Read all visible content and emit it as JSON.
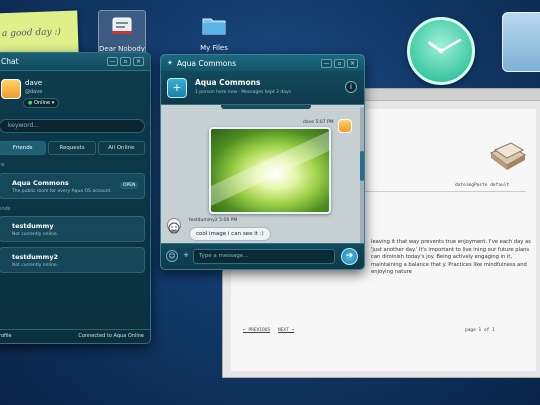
{
  "desktop": {
    "sticky_note": "a good day :)",
    "icons": [
      {
        "label": "Dear Nobody",
        "icon": "document-icon"
      },
      {
        "label": "My Files",
        "icon": "folder-icon"
      }
    ],
    "clock": {
      "hour": 10,
      "minute": 10,
      "color": "#3fc9a2"
    }
  },
  "chat_window": {
    "title": "Chat",
    "controls": [
      "—",
      "▫",
      "×"
    ],
    "user": {
      "name": "dave",
      "handle": "@dave",
      "status": "Online"
    },
    "search_placeholder": "keyword...",
    "tabs": [
      "Friends",
      "Requests",
      "All Online"
    ],
    "sections": {
      "rooms": "ms",
      "friends": "iends"
    },
    "rooms": [
      {
        "name": "Aqua Commons",
        "subtitle": "The public room for every Aqua OS account.",
        "action": "OPEN"
      }
    ],
    "friends": [
      {
        "name": "testdummy",
        "status": "Not currently online."
      },
      {
        "name": "testdummy2",
        "status": "Not currently online."
      }
    ],
    "footer_left": "rofile",
    "footer_right": "Connected to Aqua Online",
    "accent": "#1f5f74"
  },
  "conversation": {
    "title": "Aqua Commons",
    "controls": [
      "—",
      "▫",
      "×"
    ],
    "room_name": "Aqua Commons",
    "room_sub": "1 person here now · Messages kept 3 days",
    "info_label": "i",
    "messages": [
      {
        "author": "dave",
        "time": "5:07 PM",
        "type": "image"
      },
      {
        "author": "testdummy2",
        "time": "5:08 PM",
        "text": "cool image i can see it :)"
      }
    ],
    "input_placeholder": "Type a message...",
    "send_label": "➜"
  },
  "document": {
    "toolbar_text": "",
    "header_right": "dateimgPaste default",
    "body": "leaving it that way prevents true enjoyment. I've each day as 'just another day.' It's important to live ining our future plans can diminish today's joy. Being actively engaging in it, maintaining a balance that y. Practices like mindfulness and enjoying nature",
    "links": [
      "← PREVIOUS",
      "NEXT →"
    ],
    "page": "page 1 of 1"
  }
}
